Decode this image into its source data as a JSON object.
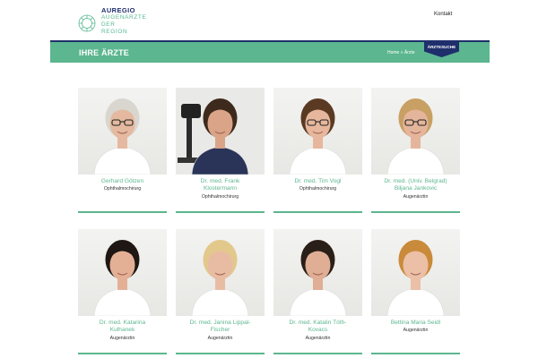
{
  "header": {
    "logo": {
      "brand": "AUREGIO",
      "lines": [
        "AUGENÄRZTE",
        "DER",
        "REGION"
      ]
    },
    "nav": {
      "kontakt": "Kontakt"
    }
  },
  "band": {
    "title": "IHRE ÄRZTE",
    "breadcrumb": {
      "home": "Home",
      "separator": " » ",
      "current": "Ärzte"
    },
    "search_tab": "ÄRZTESUCHE"
  },
  "colors": {
    "accent": "#5cb68f",
    "navy": "#1f2f6b"
  },
  "doctors": [
    {
      "name_lines": [
        "Gerhard Götzen"
      ],
      "role": "Ophthalmochirurg",
      "hair": "#d9d6cf",
      "skin": "#e4b9a0",
      "shirt": "#ffffff",
      "glasses": true,
      "bg": "light"
    },
    {
      "name_lines": [
        "Dr. med. Frank",
        "Klostermann"
      ],
      "role": "Ophthalmochirurg",
      "hair": "#3e2a1c",
      "skin": "#d9a488",
      "shirt": "#2a3458",
      "glasses": false,
      "bg": "equipment"
    },
    {
      "name_lines": [
        "Dr. med. Tim Vogl"
      ],
      "role": "Ophthalmochirurg",
      "hair": "#5a3a22",
      "skin": "#e6b79c",
      "shirt": "#ffffff",
      "glasses": true,
      "bg": "light"
    },
    {
      "name_lines": [
        "Dr. med. (Univ. Belgrad)",
        "Biljana Jankovic"
      ],
      "role": "Augenärztin",
      "hair": "#c9a063",
      "skin": "#e4b59b",
      "shirt": "#ffffff",
      "glasses": true,
      "bg": "light"
    },
    {
      "name_lines": [
        "Dr. med. Katarina",
        "Kulhanek"
      ],
      "role": "Augenärztin",
      "hair": "#1e1713",
      "skin": "#e3b096",
      "shirt": "#ffffff",
      "glasses": false,
      "bg": "light"
    },
    {
      "name_lines": [
        "Dr. med. Janina Lippal-",
        "Fischer"
      ],
      "role": "Augenärztin",
      "hair": "#e2c98b",
      "skin": "#e8bca2",
      "shirt": "#ffffff",
      "glasses": false,
      "bg": "light"
    },
    {
      "name_lines": [
        "Dr. med. Katalin Tóth-",
        "Kovacs"
      ],
      "role": "Augenärztin",
      "hair": "#2a1f18",
      "skin": "#dfae94",
      "shirt": "#ffffff",
      "glasses": false,
      "bg": "light"
    },
    {
      "name_lines": [
        "Bettina Maria Seidl"
      ],
      "role": "Augenärztin",
      "hair": "#c98a3a",
      "skin": "#ebc0a6",
      "shirt": "#ffffff",
      "glasses": false,
      "bg": "light"
    }
  ]
}
